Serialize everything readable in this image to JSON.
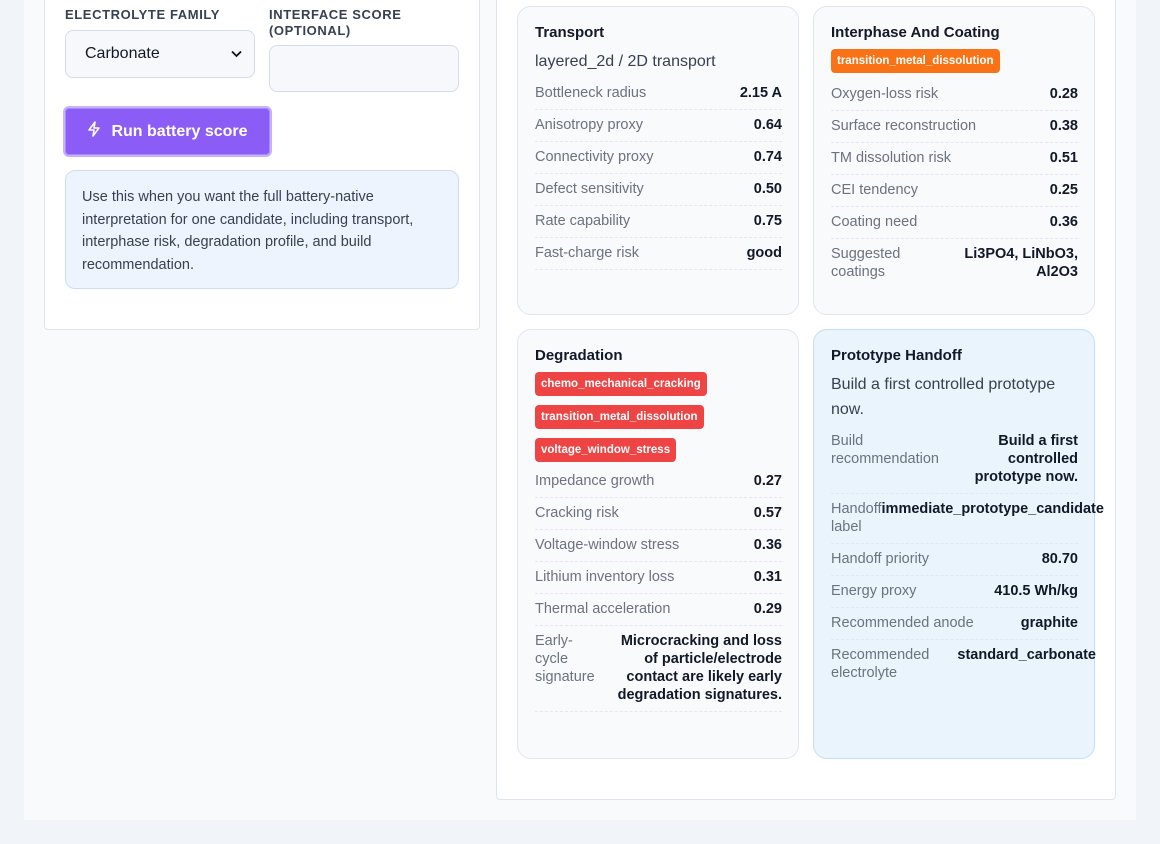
{
  "form": {
    "electrolyte_label": "ELECTROLYTE FAMILY",
    "electrolyte_value": "Carbonate",
    "interface_label_line1": "INTERFACE SCORE",
    "interface_label_line2": "(OPTIONAL)",
    "interface_value": "",
    "run_button_label": "Run battery score",
    "info_text": "Use this when you want the full battery-native interpretation for one candidate, including transport, interphase risk, degradation profile, and build recommendation."
  },
  "transport": {
    "title": "Transport",
    "subtitle": "layered_2d / 2D transport",
    "metrics": [
      {
        "label": "Bottleneck radius",
        "value": "2.15 A"
      },
      {
        "label": "Anisotropy proxy",
        "value": "0.64"
      },
      {
        "label": "Connectivity proxy",
        "value": "0.74"
      },
      {
        "label": "Defect sensitivity",
        "value": "0.50"
      },
      {
        "label": "Rate capability",
        "value": "0.75"
      },
      {
        "label": "Fast-charge risk",
        "value": "good"
      }
    ]
  },
  "interphase": {
    "title": "Interphase And Coating",
    "tag": "transition_metal_dissolution",
    "metrics": [
      {
        "label": "Oxygen-loss risk",
        "value": "0.28"
      },
      {
        "label": "Surface reconstruction",
        "value": "0.38"
      },
      {
        "label": "TM dissolution risk",
        "value": "0.51"
      },
      {
        "label": "CEI tendency",
        "value": "0.25"
      },
      {
        "label": "Coating need",
        "value": "0.36"
      },
      {
        "label": "Suggested coatings",
        "value": "Li3PO4, LiNbO3, Al2O3"
      }
    ]
  },
  "degradation": {
    "title": "Degradation",
    "tags": [
      "chemo_mechanical_cracking",
      "transition_metal_dissolution",
      "voltage_window_stress"
    ],
    "metrics": [
      {
        "label": "Impedance growth",
        "value": "0.27"
      },
      {
        "label": "Cracking risk",
        "value": "0.57"
      },
      {
        "label": "Voltage-window stress",
        "value": "0.36"
      },
      {
        "label": "Lithium inventory loss",
        "value": "0.31"
      },
      {
        "label": "Thermal acceleration",
        "value": "0.29"
      },
      {
        "label": "Early-cycle signature",
        "value": "Microcracking and loss of particle/electrode contact are likely early degradation signatures."
      }
    ]
  },
  "handoff": {
    "title": "Prototype Handoff",
    "subtitle": "Build a first controlled prototype now.",
    "metrics": [
      {
        "label": "Build recommendation",
        "value": "Build a first controlled prototype now."
      },
      {
        "label": "Handoff label",
        "value": "immediate_prototype_candidate"
      },
      {
        "label": "Handoff priority",
        "value": "80.70"
      },
      {
        "label": "Energy proxy",
        "value": "410.5 Wh/kg"
      },
      {
        "label": "Recommended anode",
        "value": "graphite"
      },
      {
        "label": "Recommended electrolyte",
        "value": "standard_carbonate"
      }
    ]
  },
  "colors": {
    "accent": "#8b5cf6",
    "tag_orange": "#f97316",
    "tag_red": "#ef4444"
  }
}
